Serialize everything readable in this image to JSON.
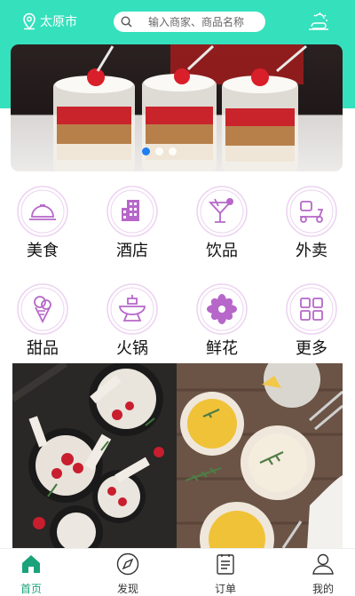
{
  "header": {
    "city": "太原市",
    "search_placeholder": "输入商家、商品名称"
  },
  "banner": {
    "slides": 3,
    "active_slide": 1
  },
  "categories": [
    {
      "label": "美食",
      "icon": "food-dome-icon"
    },
    {
      "label": "酒店",
      "icon": "hotel-icon"
    },
    {
      "label": "饮品",
      "icon": "cocktail-icon"
    },
    {
      "label": "外卖",
      "icon": "scooter-icon"
    },
    {
      "label": "甜品",
      "icon": "ice-cream-icon"
    },
    {
      "label": "火锅",
      "icon": "hotpot-icon"
    },
    {
      "label": "鲜花",
      "icon": "flower-icon"
    },
    {
      "label": "更多",
      "icon": "grid-icon"
    }
  ],
  "tabbar": [
    {
      "label": "首页",
      "icon": "home-icon",
      "active": true
    },
    {
      "label": "发现",
      "icon": "compass-icon",
      "active": false
    },
    {
      "label": "订单",
      "icon": "order-icon",
      "active": false
    },
    {
      "label": "我的",
      "icon": "user-icon",
      "active": false
    }
  ],
  "colors": {
    "header": "#35e0bd",
    "icon_purple": "#b667c9",
    "tab_active": "#1aa37a",
    "dot_active": "#1e7ff0"
  }
}
